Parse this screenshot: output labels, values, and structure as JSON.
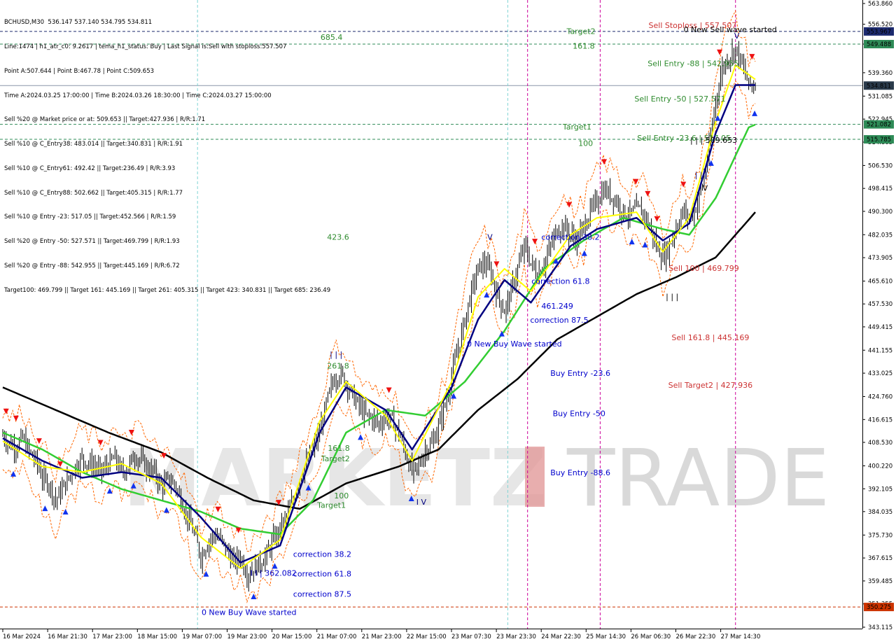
{
  "header": {
    "lines": [
      "BCHUSD,M30  536.147 537.140 534.795 534.811",
      "Line:1474 | h1_atr_c0: 9.2617 | tema_h1_status: Buy | Last Signal is:Sell with stoploss:557.507",
      "Point A:507.644 | Point B:467.78 | Point C:509.653",
      "Time A:2024.03.25 17:00:00 | Time B:2024.03.26 18:30:00 | Time C:2024.03.27 15:00:00",
      "Sell %20 @ Market price or at: 509.653 || Target:427.936 | R/R:1.71",
      "Sell %10 @ C_Entry38: 483.014 || Target:340.831 | R/R:1.91",
      "Sell %10 @ C_Entry61: 492.42 || Target:236.49 | R/R:3.93",
      "Sell %10 @ C_Entry88: 502.662 || Target:405.315 | R/R:1.77",
      "Sell %10 @ Entry -23: 517.05 || Target:452.566 | R/R:1.59",
      "Sell %20 @ Entry -50: 527.571 || Target:469.799 | R/R:1.93",
      "Sell %20 @ Entry -88: 542.955 || Target:445.169 | R/R:6.72",
      "Target100: 469.799 || Target 161: 445.169 || Target 261: 405.315 || Target 423: 340.831 || Target 685: 236.49"
    ]
  },
  "watermark": {
    "left": "MARKETZ",
    "right": "TRADE"
  },
  "colors": {
    "up_bar": "#000000",
    "yellow": "#ffff00",
    "navy": "#000080",
    "green": "#32cd32",
    "black_ma": "#000000",
    "orange": "#ff6600",
    "magenta": "#cc0099",
    "cyan": "#7fd4d4",
    "badge_green": "#2e8b57",
    "badge_blue": "#1c2a6e",
    "badge_gray": "#2a3a4a",
    "badge_red": "#cc3300",
    "label_green": "#2e8b2e",
    "label_blue": "#0000cc",
    "label_red": "#cc3333"
  },
  "chart_data": {
    "type": "candlestick",
    "title": "BCHUSD,M30",
    "ylim": [
      343.115,
      563.86
    ],
    "y_ticks": [
      "563.860",
      "556.520",
      "549.488",
      "539.360",
      "531.085",
      "522.945",
      "514.805",
      "506.530",
      "498.415",
      "490.300",
      "482.035",
      "473.905",
      "465.610",
      "457.530",
      "449.415",
      "441.155",
      "433.025",
      "424.760",
      "416.615",
      "408.530",
      "400.220",
      "392.105",
      "384.035",
      "375.730",
      "367.615",
      "359.485",
      "351.355",
      "343.115"
    ],
    "x_ticks": [
      "16 Mar 2024",
      "16 Mar 21:30",
      "17 Mar 23:00",
      "18 Mar 15:00",
      "19 Mar 07:00",
      "19 Mar 23:00",
      "20 Mar 15:00",
      "21 Mar 07:00",
      "21 Mar 23:00",
      "22 Mar 15:00",
      "23 Mar 07:30",
      "23 Mar 23:30",
      "24 Mar 22:30",
      "25 Mar 14:30",
      "26 Mar 06:30",
      "26 Mar 22:30",
      "27 Mar 14:30"
    ],
    "price_badges": [
      {
        "value": 553.967,
        "text": "553.967",
        "kind": "blue"
      },
      {
        "value": 549.488,
        "text": "549.488",
        "kind": "green"
      },
      {
        "value": 534.811,
        "text": "534.811",
        "kind": "gray"
      },
      {
        "value": 521.082,
        "text": "521.082",
        "kind": "green"
      },
      {
        "value": 515.785,
        "text": "515.785",
        "kind": "green"
      },
      {
        "value": 350.275,
        "text": "350.275",
        "kind": "red"
      }
    ],
    "price_path": [
      [
        0,
        411
      ],
      [
        1,
        408
      ],
      [
        2,
        407
      ],
      [
        3,
        410
      ],
      [
        4,
        405
      ],
      [
        5,
        402
      ],
      [
        6,
        396
      ],
      [
        7,
        394
      ],
      [
        8,
        388
      ],
      [
        9,
        392
      ],
      [
        10,
        396
      ],
      [
        11,
        400
      ],
      [
        12,
        403
      ],
      [
        13,
        401
      ],
      [
        14,
        400
      ],
      [
        15,
        398
      ],
      [
        16,
        401
      ],
      [
        17,
        403
      ],
      [
        18,
        398
      ],
      [
        19,
        400
      ],
      [
        20,
        404
      ],
      [
        21,
        402
      ],
      [
        22,
        399
      ],
      [
        23,
        398
      ],
      [
        24,
        393
      ],
      [
        25,
        395
      ],
      [
        26,
        394
      ],
      [
        27,
        388
      ],
      [
        28,
        382
      ],
      [
        29,
        376
      ],
      [
        30,
        368
      ],
      [
        31,
        373
      ],
      [
        32,
        376
      ],
      [
        33,
        374
      ],
      [
        34,
        370
      ],
      [
        35,
        366
      ],
      [
        36,
        368
      ],
      [
        37,
        362
      ],
      [
        38,
        364
      ],
      [
        39,
        366
      ],
      [
        40,
        369
      ],
      [
        41,
        374
      ],
      [
        42,
        378
      ],
      [
        43,
        382
      ],
      [
        44,
        388
      ],
      [
        45,
        396
      ],
      [
        46,
        401
      ],
      [
        47,
        406
      ],
      [
        48,
        412
      ],
      [
        49,
        422
      ],
      [
        50,
        430
      ],
      [
        51,
        433
      ],
      [
        52,
        430
      ],
      [
        53,
        425
      ],
      [
        54,
        421
      ],
      [
        55,
        418
      ],
      [
        56,
        417
      ],
      [
        57,
        415
      ],
      [
        58,
        418
      ],
      [
        59,
        416
      ],
      [
        60,
        412
      ],
      [
        61,
        405
      ],
      [
        62,
        398
      ],
      [
        63,
        400
      ],
      [
        64,
        406
      ],
      [
        65,
        408
      ],
      [
        66,
        414
      ],
      [
        67,
        422
      ],
      [
        68,
        432
      ],
      [
        69,
        442
      ],
      [
        70,
        452
      ],
      [
        71,
        462
      ],
      [
        72,
        470
      ],
      [
        73,
        472
      ],
      [
        74,
        468
      ],
      [
        75,
        460
      ],
      [
        76,
        455
      ],
      [
        77,
        462
      ],
      [
        78,
        470
      ],
      [
        79,
        478
      ],
      [
        80,
        472
      ],
      [
        81,
        468
      ],
      [
        82,
        472
      ],
      [
        83,
        478
      ],
      [
        84,
        484
      ],
      [
        85,
        485
      ],
      [
        86,
        482
      ],
      [
        87,
        480
      ],
      [
        88,
        485
      ],
      [
        89,
        490
      ],
      [
        90,
        494
      ],
      [
        91,
        498
      ],
      [
        92,
        496
      ],
      [
        93,
        494
      ],
      [
        94,
        490
      ],
      [
        95,
        489
      ],
      [
        96,
        491
      ],
      [
        97,
        490
      ],
      [
        98,
        485
      ],
      [
        99,
        478
      ],
      [
        100,
        474
      ],
      [
        101,
        478
      ],
      [
        102,
        485
      ],
      [
        103,
        490
      ],
      [
        104,
        488
      ],
      [
        105,
        492
      ],
      [
        106,
        500
      ],
      [
        107,
        512
      ],
      [
        108,
        530
      ],
      [
        109,
        541
      ],
      [
        110,
        545
      ],
      [
        111,
        548
      ],
      [
        112,
        542
      ],
      [
        113,
        535
      ],
      [
        114,
        535
      ]
    ],
    "series": [
      {
        "name": "",
        "color": "#000000",
        "values": [
          [
            0,
            428
          ],
          [
            8,
            420
          ],
          [
            16,
            412
          ],
          [
            24,
            405
          ],
          [
            31,
            396
          ],
          [
            38,
            388
          ],
          [
            45,
            385
          ],
          [
            52,
            394
          ],
          [
            60,
            400
          ],
          [
            66,
            406
          ],
          [
            72,
            420
          ],
          [
            78,
            431
          ],
          [
            84,
            445
          ],
          [
            90,
            453
          ],
          [
            96,
            461
          ],
          [
            102,
            467
          ],
          [
            108,
            474
          ],
          [
            114,
            490
          ]
        ]
      },
      {
        "name": "",
        "color": "#32cd32",
        "values": [
          [
            0,
            412
          ],
          [
            6,
            406
          ],
          [
            12,
            398
          ],
          [
            18,
            392
          ],
          [
            24,
            388
          ],
          [
            30,
            384
          ],
          [
            36,
            378
          ],
          [
            42,
            376
          ],
          [
            47,
            388
          ],
          [
            52,
            412
          ],
          [
            58,
            420
          ],
          [
            64,
            418
          ],
          [
            70,
            430
          ],
          [
            76,
            448
          ],
          [
            82,
            470
          ],
          [
            88,
            480
          ],
          [
            94,
            488
          ],
          [
            100,
            484
          ],
          [
            104,
            482
          ],
          [
            108,
            495
          ],
          [
            113,
            520
          ],
          [
            114,
            521
          ]
        ]
      },
      {
        "name": "",
        "color": "#000080",
        "values": [
          [
            0,
            410
          ],
          [
            6,
            402
          ],
          [
            12,
            396
          ],
          [
            18,
            398
          ],
          [
            24,
            396
          ],
          [
            30,
            382
          ],
          [
            36,
            366
          ],
          [
            42,
            372
          ],
          [
            48,
            412
          ],
          [
            52,
            428
          ],
          [
            58,
            420
          ],
          [
            62,
            406
          ],
          [
            68,
            428
          ],
          [
            72,
            452
          ],
          [
            76,
            466
          ],
          [
            80,
            458
          ],
          [
            86,
            478
          ],
          [
            90,
            484
          ],
          [
            96,
            488
          ],
          [
            100,
            480
          ],
          [
            104,
            486
          ],
          [
            108,
            518
          ],
          [
            111,
            535
          ],
          [
            114,
            535
          ]
        ]
      },
      {
        "name": "",
        "color": "#ffff00",
        "values": [
          [
            0,
            409
          ],
          [
            6,
            400
          ],
          [
            12,
            398
          ],
          [
            18,
            401
          ],
          [
            24,
            394
          ],
          [
            30,
            375
          ],
          [
            36,
            364
          ],
          [
            42,
            374
          ],
          [
            48,
            416
          ],
          [
            52,
            430
          ],
          [
            58,
            418
          ],
          [
            62,
            402
          ],
          [
            68,
            430
          ],
          [
            72,
            460
          ],
          [
            76,
            470
          ],
          [
            80,
            462
          ],
          [
            86,
            482
          ],
          [
            90,
            488
          ],
          [
            96,
            490
          ],
          [
            100,
            476
          ],
          [
            104,
            488
          ],
          [
            108,
            522
          ],
          [
            111,
            542
          ],
          [
            114,
            537
          ]
        ]
      }
    ],
    "hlines": [
      {
        "value": 553.967,
        "color": "#1c2a6e"
      },
      {
        "value": 549.488,
        "color": "#2e8b57"
      },
      {
        "value": 534.811,
        "color": "#8a96a8"
      },
      {
        "value": 521.082,
        "color": "#2e8b57"
      },
      {
        "value": 515.785,
        "color": "#2e8b57"
      },
      {
        "value": 350.275,
        "color": "#cc3300"
      }
    ],
    "vlines": [
      {
        "x": 29.5,
        "color": "#7fd4d4"
      },
      {
        "x": 76.5,
        "color": "#7fd4d4"
      },
      {
        "x": 79.5,
        "color": "#cc0099"
      },
      {
        "x": 90.5,
        "color": "#cc0099"
      },
      {
        "x": 111.0,
        "color": "#cc0099"
      }
    ],
    "annotations": [
      {
        "text": "Sell Stoploss | 557.507",
        "x": 104.5,
        "y": 555.2,
        "color": "#cc3333"
      },
      {
        "text": "0 New Sell wave started",
        "x": 110.2,
        "y": 553.7,
        "color": "#000000"
      },
      {
        "text": "Target2",
        "x": 87.6,
        "y": 553.1,
        "color": "#2e8b2e"
      },
      {
        "text": "685.4",
        "x": 49.8,
        "y": 551.0,
        "color": "#2e8b2e"
      },
      {
        "text": "161.8",
        "x": 88.0,
        "y": 547.9,
        "color": "#2e8b2e"
      },
      {
        "text": "Sell Entry -88 | 542.955",
        "x": 104.6,
        "y": 541.7,
        "color": "#2e8b2e"
      },
      {
        "text": "Sell Entry -50 | 527.571",
        "x": 102.6,
        "y": 529.2,
        "color": "#2e8b2e"
      },
      {
        "text": "Target1",
        "x": 87.0,
        "y": 519.3,
        "color": "#2e8b2e"
      },
      {
        "text": "100",
        "x": 88.3,
        "y": 513.5,
        "color": "#2e8b2e"
      },
      {
        "text": "Sell Entry -23.6 | 517.05",
        "x": 103.2,
        "y": 515.3,
        "color": "#2e8b2e"
      },
      {
        "text": "| | | 509.653",
        "x": 107.7,
        "y": 514.5,
        "color": "#000000"
      },
      {
        "text": "| | |",
        "x": 105.8,
        "y": 502.3,
        "color": "#000080"
      },
      {
        "text": "V",
        "x": 106.4,
        "y": 497.6,
        "color": "#000000"
      },
      {
        "text": "V",
        "x": 111.2,
        "y": 551.5,
        "color": "#000080"
      },
      {
        "text": "correction 38.2",
        "x": 86.0,
        "y": 480.2,
        "color": "#0000cc"
      },
      {
        "text": "423.6",
        "x": 50.8,
        "y": 480.2,
        "color": "#2e8b2e"
      },
      {
        "text": "V",
        "x": 73.8,
        "y": 480.2,
        "color": "#000080"
      },
      {
        "text": "Sell 100 | 469.799",
        "x": 106.2,
        "y": 469.2,
        "color": "#cc3333"
      },
      {
        "text": "correction 61.8",
        "x": 84.5,
        "y": 464.6,
        "color": "#0000cc"
      },
      {
        "text": "| | |",
        "x": 101.4,
        "y": 459.2,
        "color": "#000000"
      },
      {
        "text": "461.249",
        "x": 84.0,
        "y": 455.8,
        "color": "#0000cc"
      },
      {
        "text": "correction 87.5",
        "x": 84.3,
        "y": 450.9,
        "color": "#0000cc"
      },
      {
        "text": "Sell 161.8 | 445.169",
        "x": 107.2,
        "y": 444.7,
        "color": "#cc3333"
      },
      {
        "text": "0 New Buy Wave started",
        "x": 77.5,
        "y": 442.5,
        "color": "#0000cc"
      },
      {
        "text": "Buy Entry -23.6",
        "x": 87.5,
        "y": 432.0,
        "color": "#0000cc"
      },
      {
        "text": "Sell Target2 | 427.936",
        "x": 107.2,
        "y": 427.9,
        "color": "#cc3333"
      },
      {
        "text": "Buy Entry -50",
        "x": 87.3,
        "y": 417.8,
        "color": "#0000cc"
      },
      {
        "text": "| | |",
        "x": 50.5,
        "y": 438.7,
        "color": "#000080"
      },
      {
        "text": "261.8",
        "x": 50.8,
        "y": 434.6,
        "color": "#2e8b2e"
      },
      {
        "text": "161.8",
        "x": 50.9,
        "y": 405.6,
        "color": "#2e8b2e"
      },
      {
        "text": "Target2",
        "x": 50.4,
        "y": 401.8,
        "color": "#2e8b2e"
      },
      {
        "text": "Buy Entry -88.6",
        "x": 87.5,
        "y": 396.9,
        "color": "#0000cc"
      },
      {
        "text": "100",
        "x": 51.3,
        "y": 388.7,
        "color": "#2e8b2e"
      },
      {
        "text": "I V",
        "x": 63.4,
        "y": 386.5,
        "color": "#000080"
      },
      {
        "text": "Target1",
        "x": 49.8,
        "y": 385.4,
        "color": "#2e8b2e"
      },
      {
        "text": "correction 38.2",
        "x": 48.4,
        "y": 368.0,
        "color": "#0000cc"
      },
      {
        "text": "I I | 362.082",
        "x": 41.0,
        "y": 361.3,
        "color": "#0000cc"
      },
      {
        "text": "correction 61.8",
        "x": 48.4,
        "y": 361.1,
        "color": "#0000cc"
      },
      {
        "text": "correction 87.5",
        "x": 48.4,
        "y": 353.9,
        "color": "#0000cc"
      },
      {
        "text": "0 New Buy Wave started",
        "x": 37.3,
        "y": 347.5,
        "color": "#0000cc"
      }
    ]
  }
}
